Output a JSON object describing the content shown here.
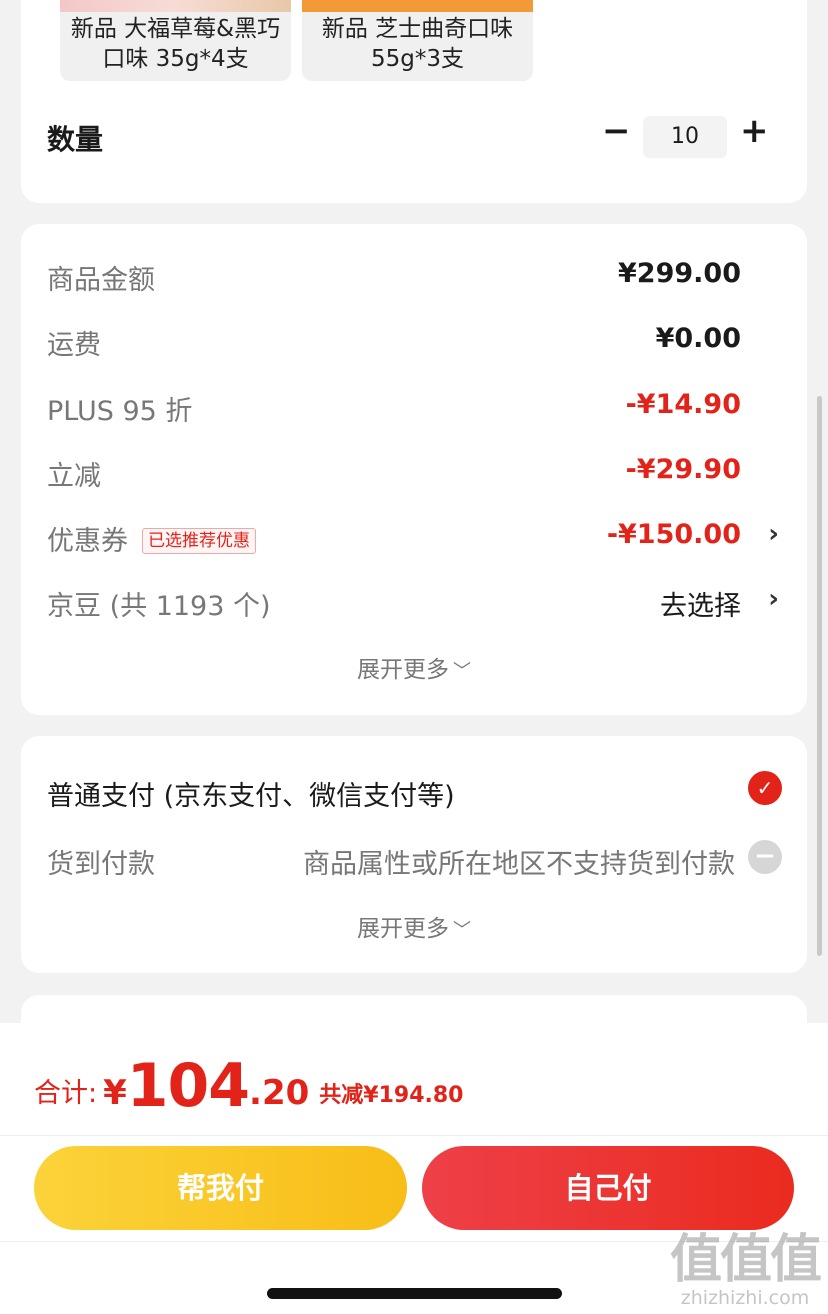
{
  "products": [
    {
      "name": "新品 大福草莓&黑巧口味 35g*4支"
    },
    {
      "name": "新品 芝士曲奇口味 55g*3支"
    }
  ],
  "quantity": {
    "label": "数量",
    "minus": "−",
    "value": "10",
    "plus": "+"
  },
  "price_rows": {
    "goods": {
      "label": "商品金额",
      "value": "¥299.00"
    },
    "shipping": {
      "label": "运费",
      "value": "¥0.00"
    },
    "plus": {
      "label": "PLUS 95 折",
      "value": "-¥14.90"
    },
    "instant": {
      "label": "立减",
      "value": "-¥29.90"
    },
    "coupon": {
      "label": "优惠券",
      "tag": "已选推荐优惠",
      "value": "-¥150.00",
      "chevron": "›"
    },
    "jingdou": {
      "label": "京豆 (共 1193 个)",
      "value": "去选择",
      "chevron": "›"
    }
  },
  "expand_more": {
    "label": "展开更多",
    "arrow": "﹀"
  },
  "payment": {
    "normal": {
      "label": "普通支付 (京东支付、微信支付等)",
      "check": "✓"
    },
    "cod": {
      "label": "货到付款",
      "note": "商品属性或所在地区不支持货到付款",
      "check": "−"
    },
    "expand_label": "展开更多",
    "expand_arrow": "﹀"
  },
  "total": {
    "label": "合计:",
    "currency": "¥",
    "integer": "104",
    "decimal": ".20",
    "saved": "共减¥194.80"
  },
  "buttons": {
    "help_pay": "帮我付",
    "self_pay": "自己付"
  },
  "watermark": {
    "big": "值值值",
    "small": "zhizhizhi.com"
  },
  "colors": {
    "accent_red": "#e2231a",
    "help_yellow": "#f8bd17",
    "background": "#f2f2f2"
  }
}
